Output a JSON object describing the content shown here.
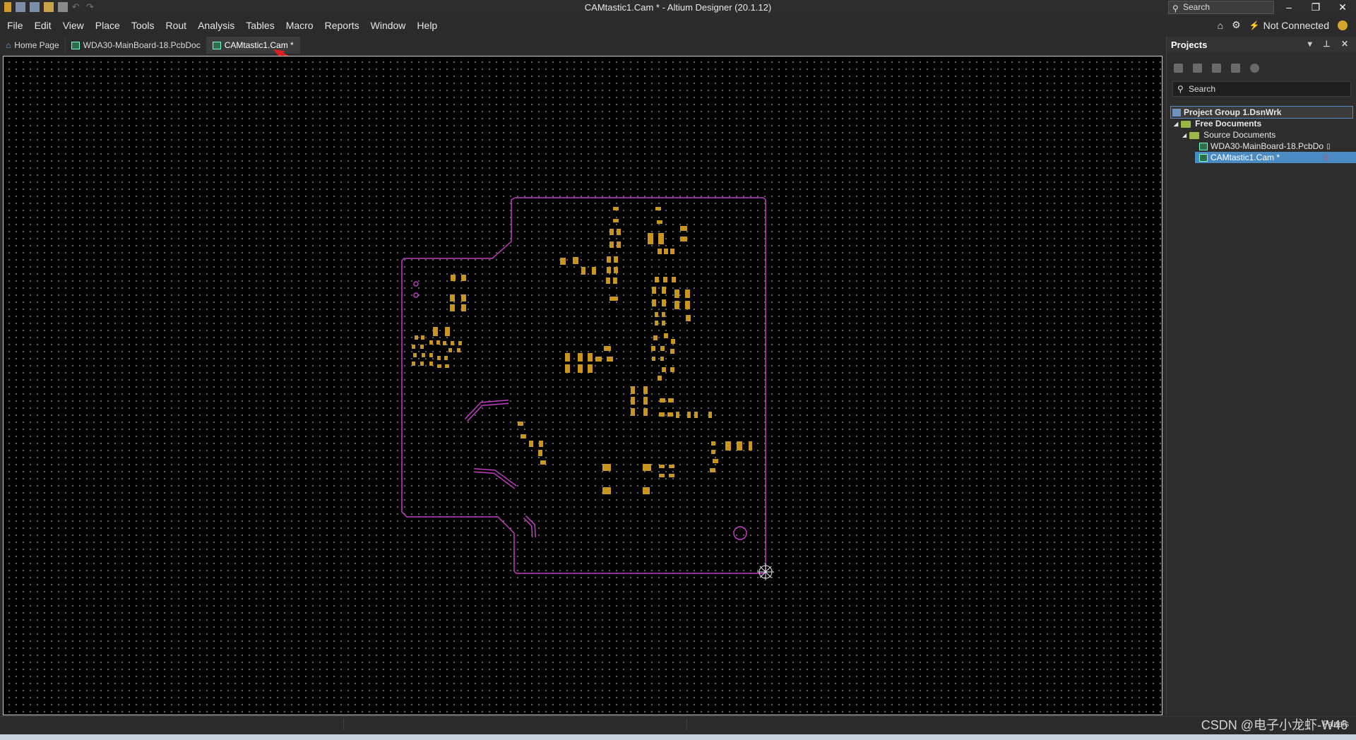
{
  "window": {
    "title": "CAMtastic1.Cam * - Altium Designer (20.1.12)",
    "search": "Search"
  },
  "menu": [
    "File",
    "Edit",
    "View",
    "Place",
    "Tools",
    "Rout",
    "Analysis",
    "Tables",
    "Macro",
    "Reports",
    "Window",
    "Help"
  ],
  "toolbar_right": {
    "connection": "Not Connected"
  },
  "tabs": [
    {
      "label": "Home Page",
      "icon": "home-icon"
    },
    {
      "label": "WDA30-MainBoard-18.PcbDoc",
      "icon": "pcb-doc-icon"
    },
    {
      "label": "CAMtastic1.Cam *",
      "icon": "cam-doc-icon",
      "active": true
    }
  ],
  "projects_panel": {
    "title": "Projects",
    "search_placeholder": "Search",
    "tree": {
      "group": "Project Group 1.DsnWrk",
      "free_documents": "Free Documents",
      "source_documents": "Source Documents",
      "files": [
        "WDA30-MainBoard-18.PcbDo",
        "CAMtastic1.Cam *"
      ]
    }
  },
  "status": {
    "panels": "Panels"
  },
  "watermark": "CSDN @电子小龙虾-W46",
  "colors": {
    "board_outline": "#c43dc4",
    "pads": "#c8961e",
    "background": "#000000",
    "annotation_arrow": "#e02020"
  }
}
